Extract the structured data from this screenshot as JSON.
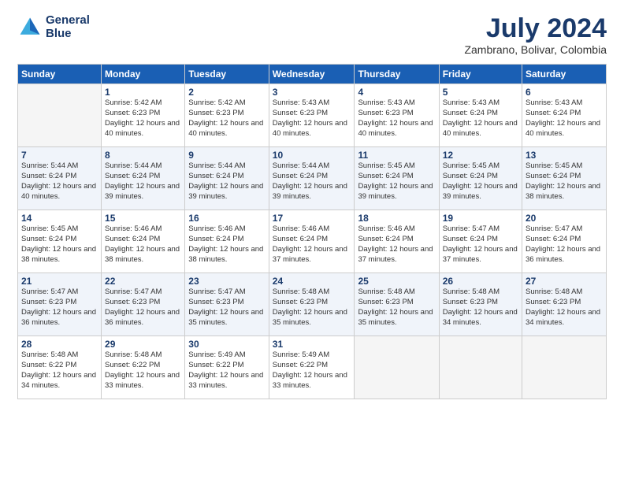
{
  "header": {
    "logo_line1": "General",
    "logo_line2": "Blue",
    "month_title": "July 2024",
    "location": "Zambrano, Bolivar, Colombia"
  },
  "days_of_week": [
    "Sunday",
    "Monday",
    "Tuesday",
    "Wednesday",
    "Thursday",
    "Friday",
    "Saturday"
  ],
  "weeks": [
    [
      {
        "day": "",
        "sunrise": "",
        "sunset": "",
        "daylight": ""
      },
      {
        "day": "1",
        "sunrise": "5:42 AM",
        "sunset": "6:23 PM",
        "daylight": "12 hours and 40 minutes."
      },
      {
        "day": "2",
        "sunrise": "5:42 AM",
        "sunset": "6:23 PM",
        "daylight": "12 hours and 40 minutes."
      },
      {
        "day": "3",
        "sunrise": "5:43 AM",
        "sunset": "6:23 PM",
        "daylight": "12 hours and 40 minutes."
      },
      {
        "day": "4",
        "sunrise": "5:43 AM",
        "sunset": "6:23 PM",
        "daylight": "12 hours and 40 minutes."
      },
      {
        "day": "5",
        "sunrise": "5:43 AM",
        "sunset": "6:24 PM",
        "daylight": "12 hours and 40 minutes."
      },
      {
        "day": "6",
        "sunrise": "5:43 AM",
        "sunset": "6:24 PM",
        "daylight": "12 hours and 40 minutes."
      }
    ],
    [
      {
        "day": "7",
        "sunrise": "5:44 AM",
        "sunset": "6:24 PM",
        "daylight": "12 hours and 40 minutes."
      },
      {
        "day": "8",
        "sunrise": "5:44 AM",
        "sunset": "6:24 PM",
        "daylight": "12 hours and 39 minutes."
      },
      {
        "day": "9",
        "sunrise": "5:44 AM",
        "sunset": "6:24 PM",
        "daylight": "12 hours and 39 minutes."
      },
      {
        "day": "10",
        "sunrise": "5:44 AM",
        "sunset": "6:24 PM",
        "daylight": "12 hours and 39 minutes."
      },
      {
        "day": "11",
        "sunrise": "5:45 AM",
        "sunset": "6:24 PM",
        "daylight": "12 hours and 39 minutes."
      },
      {
        "day": "12",
        "sunrise": "5:45 AM",
        "sunset": "6:24 PM",
        "daylight": "12 hours and 39 minutes."
      },
      {
        "day": "13",
        "sunrise": "5:45 AM",
        "sunset": "6:24 PM",
        "daylight": "12 hours and 38 minutes."
      }
    ],
    [
      {
        "day": "14",
        "sunrise": "5:45 AM",
        "sunset": "6:24 PM",
        "daylight": "12 hours and 38 minutes."
      },
      {
        "day": "15",
        "sunrise": "5:46 AM",
        "sunset": "6:24 PM",
        "daylight": "12 hours and 38 minutes."
      },
      {
        "day": "16",
        "sunrise": "5:46 AM",
        "sunset": "6:24 PM",
        "daylight": "12 hours and 38 minutes."
      },
      {
        "day": "17",
        "sunrise": "5:46 AM",
        "sunset": "6:24 PM",
        "daylight": "12 hours and 37 minutes."
      },
      {
        "day": "18",
        "sunrise": "5:46 AM",
        "sunset": "6:24 PM",
        "daylight": "12 hours and 37 minutes."
      },
      {
        "day": "19",
        "sunrise": "5:47 AM",
        "sunset": "6:24 PM",
        "daylight": "12 hours and 37 minutes."
      },
      {
        "day": "20",
        "sunrise": "5:47 AM",
        "sunset": "6:24 PM",
        "daylight": "12 hours and 36 minutes."
      }
    ],
    [
      {
        "day": "21",
        "sunrise": "5:47 AM",
        "sunset": "6:23 PM",
        "daylight": "12 hours and 36 minutes."
      },
      {
        "day": "22",
        "sunrise": "5:47 AM",
        "sunset": "6:23 PM",
        "daylight": "12 hours and 36 minutes."
      },
      {
        "day": "23",
        "sunrise": "5:47 AM",
        "sunset": "6:23 PM",
        "daylight": "12 hours and 35 minutes."
      },
      {
        "day": "24",
        "sunrise": "5:48 AM",
        "sunset": "6:23 PM",
        "daylight": "12 hours and 35 minutes."
      },
      {
        "day": "25",
        "sunrise": "5:48 AM",
        "sunset": "6:23 PM",
        "daylight": "12 hours and 35 minutes."
      },
      {
        "day": "26",
        "sunrise": "5:48 AM",
        "sunset": "6:23 PM",
        "daylight": "12 hours and 34 minutes."
      },
      {
        "day": "27",
        "sunrise": "5:48 AM",
        "sunset": "6:23 PM",
        "daylight": "12 hours and 34 minutes."
      }
    ],
    [
      {
        "day": "28",
        "sunrise": "5:48 AM",
        "sunset": "6:22 PM",
        "daylight": "12 hours and 34 minutes."
      },
      {
        "day": "29",
        "sunrise": "5:48 AM",
        "sunset": "6:22 PM",
        "daylight": "12 hours and 33 minutes."
      },
      {
        "day": "30",
        "sunrise": "5:49 AM",
        "sunset": "6:22 PM",
        "daylight": "12 hours and 33 minutes."
      },
      {
        "day": "31",
        "sunrise": "5:49 AM",
        "sunset": "6:22 PM",
        "daylight": "12 hours and 33 minutes."
      },
      {
        "day": "",
        "sunrise": "",
        "sunset": "",
        "daylight": ""
      },
      {
        "day": "",
        "sunrise": "",
        "sunset": "",
        "daylight": ""
      },
      {
        "day": "",
        "sunrise": "",
        "sunset": "",
        "daylight": ""
      }
    ]
  ]
}
